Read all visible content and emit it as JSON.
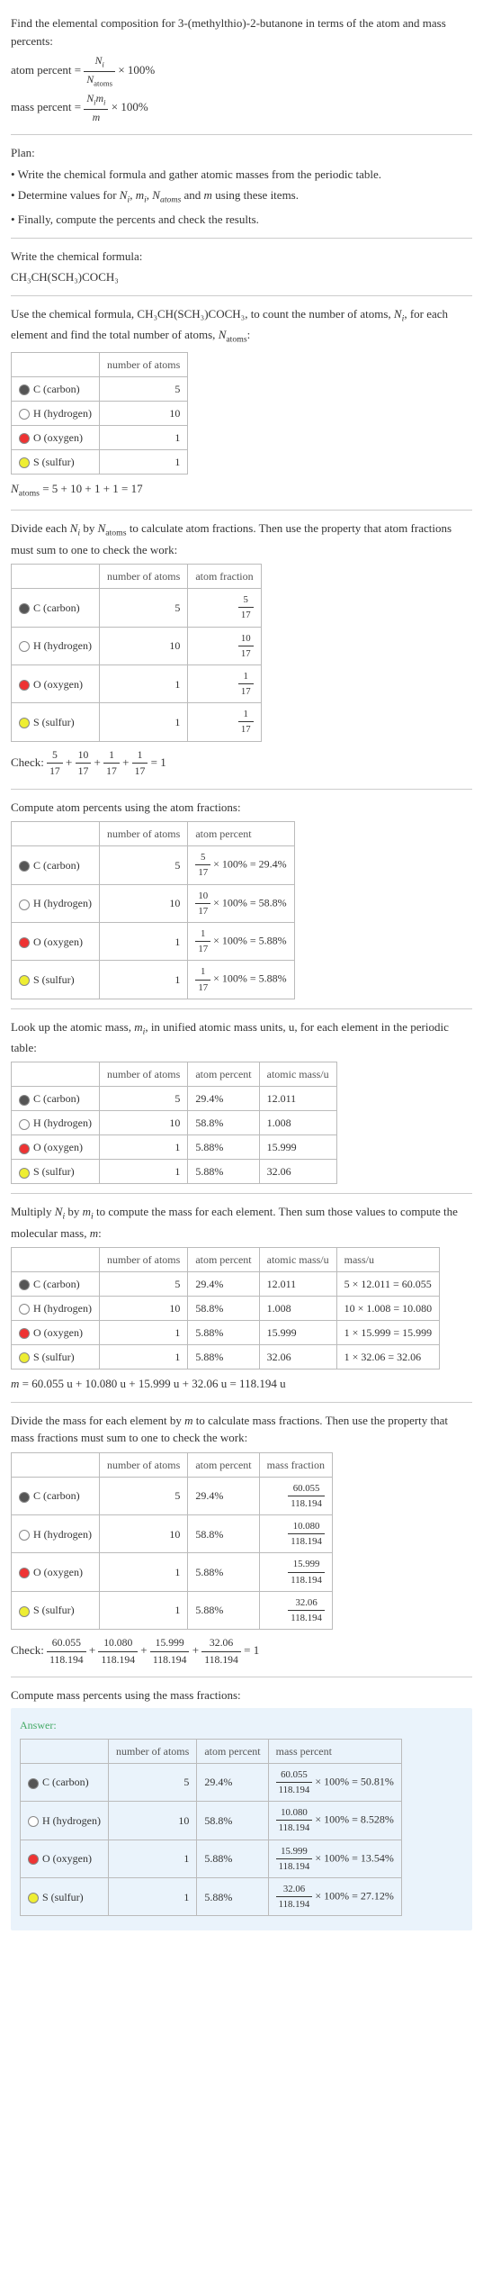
{
  "intro": {
    "line1": "Find the elemental composition for 3-(methylthio)-2-butanone in terms of the atom and mass percents:",
    "atom_percent_label": "atom percent",
    "mass_percent_label": "mass percent",
    "eq_times100": " × 100%",
    "frac_atom_num": "N_i",
    "frac_atom_den": "N_atoms",
    "frac_mass_num": "N_i m_i",
    "frac_mass_den": "m"
  },
  "plan": {
    "heading": "Plan:",
    "b1": "• Write the chemical formula and gather atomic masses from the periodic table.",
    "b2_prefix": "• Determine values for ",
    "b2_vars": "N_i, m_i, N_atoms and m",
    "b2_suffix": " using these items.",
    "b3": "• Finally, compute the percents and check the results."
  },
  "step_formula": {
    "heading": "Write the chemical formula:",
    "formula": "CH₃CH(SCH₃)COCH₃"
  },
  "step_count": {
    "text_a": "Use the chemical formula, CH₃CH(SCH₃)COCH₃, to count the number of atoms, ",
    "text_b": ", for each element and find the total number of atoms, ",
    "text_c": ":",
    "ni": "N_i",
    "natoms": "N_atoms"
  },
  "elements": {
    "c_label": "C (carbon)",
    "h_label": "H (hydrogen)",
    "o_label": "O (oxygen)",
    "s_label": "S (sulfur)"
  },
  "headers": {
    "number_of_atoms": "number of atoms",
    "atom_fraction": "atom fraction",
    "atom_percent": "atom percent",
    "atomic_mass": "atomic mass/u",
    "mass": "mass/u",
    "mass_fraction": "mass fraction",
    "mass_percent": "mass percent"
  },
  "counts": {
    "c": "5",
    "h": "10",
    "o": "1",
    "s": "1"
  },
  "natoms_line": "N_atoms = 5 + 10 + 1 + 1 = 17",
  "divide_atoms": {
    "text": "Divide each N_i by N_atoms to calculate atom fractions. Then use the property that atom fractions must sum to one to check the work:"
  },
  "atom_frac": {
    "c": "5/17",
    "h": "10/17",
    "o": "1/17",
    "s": "1/17"
  },
  "check_atom": "Check: 5/17 + 10/17 + 1/17 + 1/17 = 1",
  "atom_pct_intro": "Compute atom percents using the atom fractions:",
  "atom_pct": {
    "c_expr": "5/17 × 100% = 29.4%",
    "h_expr": "10/17 × 100% = 58.8%",
    "o_expr": "1/17 × 100% = 5.88%",
    "s_expr": "1/17 × 100% = 5.88%",
    "c": "29.4%",
    "h": "58.8%",
    "o": "5.88%",
    "s": "5.88%"
  },
  "lookup_intro": "Look up the atomic mass, m_i, in unified atomic mass units, u, for each element in the periodic table:",
  "atomic_mass": {
    "c": "12.011",
    "h": "1.008",
    "o": "15.999",
    "s": "32.06"
  },
  "multiply_intro": "Multiply N_i by m_i to compute the mass for each element. Then sum those values to compute the molecular mass, m:",
  "mass_calc": {
    "c": "5 × 12.011 = 60.055",
    "h": "10 × 1.008 = 10.080",
    "o": "1 × 15.999 = 15.999",
    "s": "1 × 32.06 = 32.06"
  },
  "m_total": "m = 60.055 u + 10.080 u + 15.999 u + 32.06 u = 118.194 u",
  "mass_frac_intro": "Divide the mass for each element by m to calculate mass fractions. Then use the property that mass fractions must sum to one to check the work:",
  "mass_frac": {
    "c": "60.055/118.194",
    "h": "10.080/118.194",
    "o": "15.999/118.194",
    "s": "32.06/118.194"
  },
  "check_mass": "Check: 60.055/118.194 + 10.080/118.194 + 15.999/118.194 + 32.06/118.194 = 1",
  "mass_pct_intro": "Compute mass percents using the mass fractions:",
  "answer_label": "Answer:",
  "mass_pct": {
    "c": "60.055/118.194 × 100% = 50.81%",
    "h": "10.080/118.194 × 100% = 8.528%",
    "o": "15.999/118.194 × 100% = 13.54%",
    "s": "32.06/118.194 × 100% = 27.12%"
  },
  "chart_data": {
    "type": "table",
    "title": "Elemental composition of 3-(methylthio)-2-butanone",
    "molecular_formula": "CH3CH(SCH3)COCH3",
    "N_atoms": 17,
    "molecular_mass_u": 118.194,
    "elements": [
      {
        "symbol": "C",
        "name": "carbon",
        "N_i": 5,
        "atom_fraction": "5/17",
        "atom_percent": 29.4,
        "atomic_mass_u": 12.011,
        "mass_u": 60.055,
        "mass_fraction": "60.055/118.194",
        "mass_percent": 50.81
      },
      {
        "symbol": "H",
        "name": "hydrogen",
        "N_i": 10,
        "atom_fraction": "10/17",
        "atom_percent": 58.8,
        "atomic_mass_u": 1.008,
        "mass_u": 10.08,
        "mass_fraction": "10.080/118.194",
        "mass_percent": 8.528
      },
      {
        "symbol": "O",
        "name": "oxygen",
        "N_i": 1,
        "atom_fraction": "1/17",
        "atom_percent": 5.88,
        "atomic_mass_u": 15.999,
        "mass_u": 15.999,
        "mass_fraction": "15.999/118.194",
        "mass_percent": 13.54
      },
      {
        "symbol": "S",
        "name": "sulfur",
        "N_i": 1,
        "atom_fraction": "1/17",
        "atom_percent": 5.88,
        "atomic_mass_u": 32.06,
        "mass_u": 32.06,
        "mass_fraction": "32.06/118.194",
        "mass_percent": 27.12
      }
    ]
  }
}
